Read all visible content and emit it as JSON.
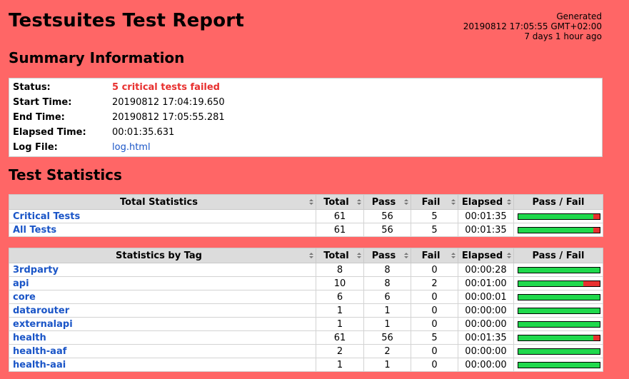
{
  "header": {
    "title": "Testsuites Test Report",
    "generated_label": "Generated",
    "generated_time": "20190812 17:05:55 GMT+02:00",
    "generated_ago": "7 days 1 hour ago"
  },
  "summary": {
    "title": "Summary Information",
    "rows": [
      {
        "label": "Status:",
        "value": "5 critical tests failed"
      },
      {
        "label": "Start Time:",
        "value": "20190812 17:04:19.650"
      },
      {
        "label": "End Time:",
        "value": "20190812 17:05:55.281"
      },
      {
        "label": "Elapsed Time:",
        "value": "00:01:35.631"
      },
      {
        "label": "Log File:",
        "value": "log.html"
      }
    ]
  },
  "statistics": {
    "title": "Test Statistics",
    "columns": {
      "total": "Total",
      "pass": "Pass",
      "fail": "Fail",
      "elapsed": "Elapsed",
      "graph": "Pass / Fail"
    },
    "total_table": {
      "header": "Total Statistics",
      "rows": [
        {
          "name": "Critical Tests",
          "total": "61",
          "pass": "56",
          "fail": "5",
          "elapsed": "00:01:35"
        },
        {
          "name": "All Tests",
          "total": "61",
          "pass": "56",
          "fail": "5",
          "elapsed": "00:01:35"
        }
      ]
    },
    "tag_table": {
      "header": "Statistics by Tag",
      "rows": [
        {
          "name": "3rdparty",
          "total": "8",
          "pass": "8",
          "fail": "0",
          "elapsed": "00:00:28"
        },
        {
          "name": "api",
          "total": "10",
          "pass": "8",
          "fail": "2",
          "elapsed": "00:01:00"
        },
        {
          "name": "core",
          "total": "6",
          "pass": "6",
          "fail": "0",
          "elapsed": "00:00:01"
        },
        {
          "name": "datarouter",
          "total": "1",
          "pass": "1",
          "fail": "0",
          "elapsed": "00:00:00"
        },
        {
          "name": "externalapi",
          "total": "1",
          "pass": "1",
          "fail": "0",
          "elapsed": "00:00:00"
        },
        {
          "name": "health",
          "total": "61",
          "pass": "56",
          "fail": "5",
          "elapsed": "00:01:35"
        },
        {
          "name": "health-aaf",
          "total": "2",
          "pass": "2",
          "fail": "0",
          "elapsed": "00:00:00"
        },
        {
          "name": "health-aai",
          "total": "1",
          "pass": "1",
          "fail": "0",
          "elapsed": "00:00:00"
        }
      ]
    }
  },
  "colors": {
    "background": "#ff6666",
    "pass": "#1fd94c",
    "fail": "#e8302f",
    "link": "#1a55c7"
  }
}
